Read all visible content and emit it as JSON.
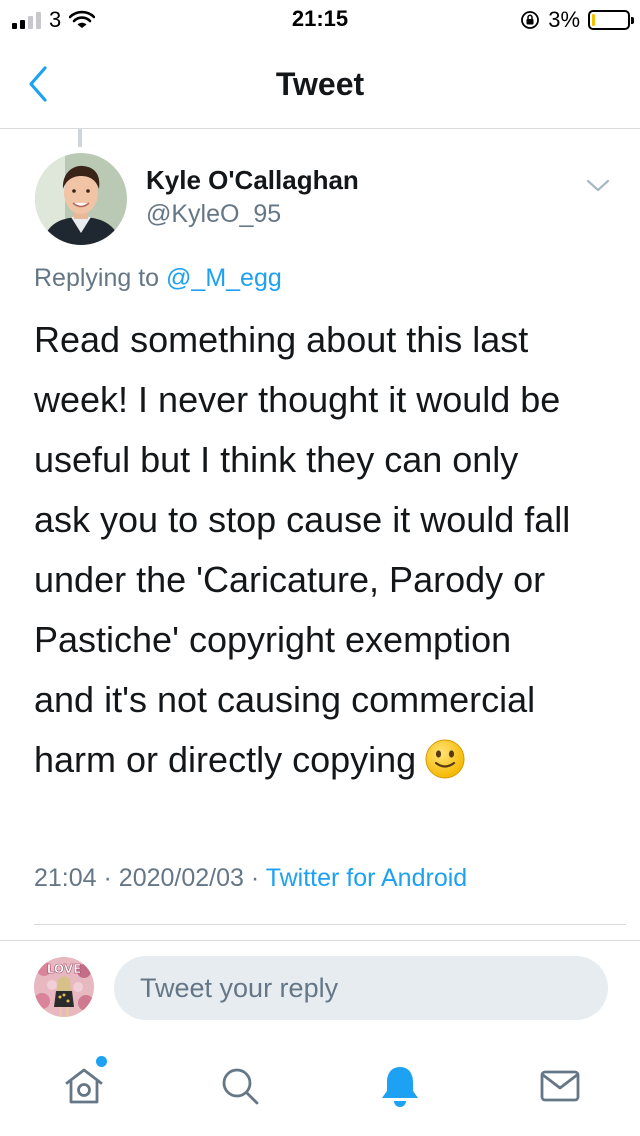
{
  "status_bar": {
    "carrier": "3",
    "time": "21:15",
    "battery_percent": "3%",
    "battery_level": 0.03,
    "signal_bars_filled": 2,
    "signal_bars_total": 4
  },
  "nav": {
    "title": "Tweet",
    "back_icon": "chevron-left-icon"
  },
  "tweet": {
    "author_name": "Kyle O'Callaghan",
    "author_handle": "@KyleO_95",
    "replying_prefix": "Replying to",
    "replying_handle": "@_M_egg",
    "lines": [
      "Read something about this last",
      "week! I never thought it would be",
      "useful but I think they can only",
      "ask you to stop cause it would fall",
      "under the 'Caricature, Parody or",
      "Pastiche' copyright exemption",
      "and it's not causing commercial",
      "harm or directly copying"
    ],
    "emoji": "slightly-smiling-face",
    "time": "21:04",
    "date": "2020/02/03",
    "source": "Twitter for Android",
    "separator": "·"
  },
  "reply": {
    "placeholder": "Tweet your reply"
  },
  "tabs": [
    {
      "icon": "home-icon",
      "active": false,
      "has_dot": true
    },
    {
      "icon": "search-icon",
      "active": false
    },
    {
      "icon": "bell-icon",
      "active": true
    },
    {
      "icon": "mail-icon",
      "active": false
    }
  ],
  "colors": {
    "accent": "#1da1f2",
    "text": "#14171a",
    "secondary": "#657786",
    "input_bg": "#e6ecf0",
    "divider": "#d7dbde"
  }
}
